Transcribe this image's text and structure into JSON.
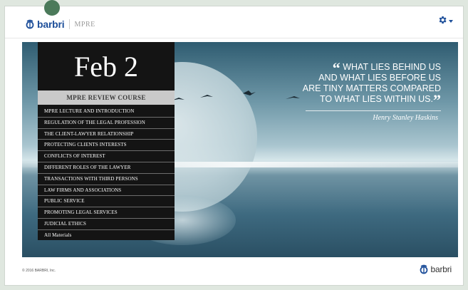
{
  "header": {
    "brand": "barbri",
    "product": "MPRE",
    "settings_icon": "gear-icon"
  },
  "hero": {
    "date": "Feb 2",
    "course_title": "MPRE REVIEW COURSE",
    "quote": {
      "lines": [
        "WHAT LIES BEHIND US",
        "AND WHAT LIES BEFORE US",
        "ARE TINY MATTERS COMPARED",
        "TO WHAT LIES WITHIN US."
      ],
      "open_mark": "“",
      "close_mark": "”",
      "author": "Henry Stanley Haskins"
    },
    "menu_items": [
      "MPRE LECTURE AND INTRODUCTION",
      "REGULATION OF THE LEGAL PROFESSION",
      "THE CLIENT-LAWYER RELATIONSHIP",
      "PROTECTING CLIENTS INTERESTS",
      "CONFLICTS OF INTEREST",
      "DIFFERENT ROLES OF THE LAWYER",
      "TRANSACTIONS WITH THIRD PERSONS",
      "LAW FIRMS AND ASSOCIATIONS",
      "PUBLIC SERVICE",
      "PROMOTING LEGAL SERVICES",
      "JUDICIAL ETHICS",
      "All Materials"
    ]
  },
  "footer": {
    "copyright": "© 2016 BARBRI, Inc.",
    "brand": "barbri"
  },
  "colors": {
    "brand_blue": "#1e4f9a",
    "accent_green": "#4b7a5a",
    "menu_bg": "#141414"
  }
}
